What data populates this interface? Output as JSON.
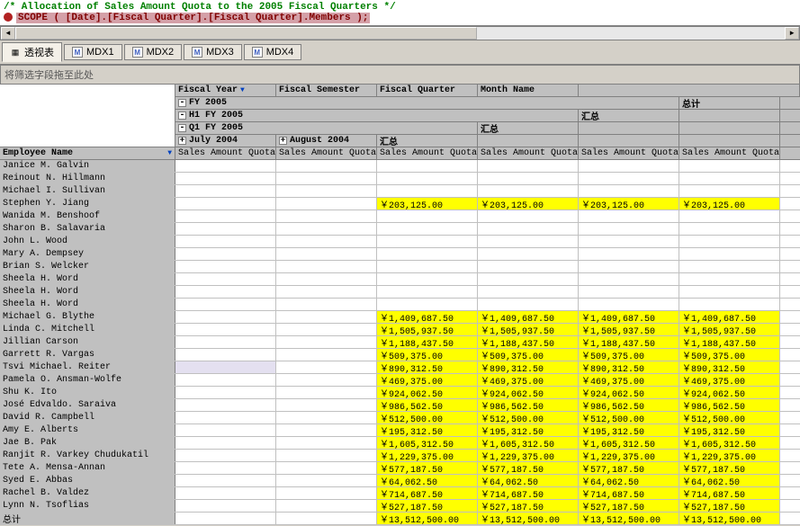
{
  "code": {
    "line1": "/* Allocation of Sales Amount Quota to the 2005 Fiscal Quarters */",
    "line2": "SCOPE ( [Date].[Fiscal Quarter].[Fiscal Quarter].Members );"
  },
  "tabs": {
    "pivot": "透视表",
    "mdx1": "MDX1",
    "mdx2": "MDX2",
    "mdx3": "MDX3",
    "mdx4": "MDX4"
  },
  "drop_label": "将筛选字段拖至此处",
  "col_fields": {
    "fiscal_year": "Fiscal Year",
    "fiscal_semester": "Fiscal Semester",
    "fiscal_quarter": "Fiscal Quarter",
    "month_name": "Month Name"
  },
  "row_field": "Employee Name",
  "measure": "Sales Amount Quota",
  "hierarchy": {
    "fy": "FY 2005",
    "h1": "H1 FY 2005",
    "q1": "Q1 FY 2005",
    "m1": "July 2004",
    "m2": "August 2004",
    "subtotal": "汇总",
    "grandtotal": "总计"
  },
  "rows": [
    {
      "name": "Janice M. Galvin",
      "v": [
        "",
        "",
        "",
        "",
        "",
        ""
      ]
    },
    {
      "name": "Reinout N. Hillmann",
      "v": [
        "",
        "",
        "",
        "",
        "",
        ""
      ]
    },
    {
      "name": "Michael I. Sullivan",
      "v": [
        "",
        "",
        "",
        "",
        "",
        ""
      ]
    },
    {
      "name": "Stephen Y. Jiang",
      "v": [
        "",
        "",
        "￥203,125.00",
        "￥203,125.00",
        "￥203,125.00",
        "￥203,125.00"
      ],
      "hl": true
    },
    {
      "name": "Wanida M. Benshoof",
      "v": [
        "",
        "",
        "",
        "",
        "",
        ""
      ]
    },
    {
      "name": "Sharon B. Salavaria",
      "v": [
        "",
        "",
        "",
        "",
        "",
        ""
      ]
    },
    {
      "name": "John L. Wood",
      "v": [
        "",
        "",
        "",
        "",
        "",
        ""
      ]
    },
    {
      "name": "Mary A. Dempsey",
      "v": [
        "",
        "",
        "",
        "",
        "",
        ""
      ]
    },
    {
      "name": "Brian S. Welcker",
      "v": [
        "",
        "",
        "",
        "",
        "",
        ""
      ]
    },
    {
      "name": "Sheela H. Word",
      "v": [
        "",
        "",
        "",
        "",
        "",
        ""
      ]
    },
    {
      "name": "Sheela H. Word",
      "v": [
        "",
        "",
        "",
        "",
        "",
        ""
      ]
    },
    {
      "name": "Sheela H. Word",
      "v": [
        "",
        "",
        "",
        "",
        "",
        ""
      ]
    },
    {
      "name": "Michael G. Blythe",
      "v": [
        "",
        "",
        "￥1,409,687.50",
        "￥1,409,687.50",
        "￥1,409,687.50",
        "￥1,409,687.50"
      ],
      "hl": true
    },
    {
      "name": "Linda C. Mitchell",
      "v": [
        "",
        "",
        "￥1,505,937.50",
        "￥1,505,937.50",
        "￥1,505,937.50",
        "￥1,505,937.50"
      ],
      "hl": true
    },
    {
      "name": "Jillian Carson",
      "v": [
        "",
        "",
        "￥1,188,437.50",
        "￥1,188,437.50",
        "￥1,188,437.50",
        "￥1,188,437.50"
      ],
      "hl": true
    },
    {
      "name": "Garrett R. Vargas",
      "v": [
        "",
        "",
        "￥509,375.00",
        "￥509,375.00",
        "￥509,375.00",
        "￥509,375.00"
      ],
      "hl": true
    },
    {
      "name": "Tsvi Michael. Reiter",
      "v": [
        "",
        "",
        "￥890,312.50",
        "￥890,312.50",
        "￥890,312.50",
        "￥890,312.50"
      ],
      "hl": true,
      "sel": true
    },
    {
      "name": "Pamela O. Ansman-Wolfe",
      "v": [
        "",
        "",
        "￥469,375.00",
        "￥469,375.00",
        "￥469,375.00",
        "￥469,375.00"
      ],
      "hl": true
    },
    {
      "name": "Shu K. Ito",
      "v": [
        "",
        "",
        "￥924,062.50",
        "￥924,062.50",
        "￥924,062.50",
        "￥924,062.50"
      ],
      "hl": true
    },
    {
      "name": "José Edvaldo. Saraiva",
      "v": [
        "",
        "",
        "￥986,562.50",
        "￥986,562.50",
        "￥986,562.50",
        "￥986,562.50"
      ],
      "hl": true
    },
    {
      "name": "David R. Campbell",
      "v": [
        "",
        "",
        "￥512,500.00",
        "￥512,500.00",
        "￥512,500.00",
        "￥512,500.00"
      ],
      "hl": true
    },
    {
      "name": "Amy E. Alberts",
      "v": [
        "",
        "",
        "￥195,312.50",
        "￥195,312.50",
        "￥195,312.50",
        "￥195,312.50"
      ],
      "hl": true
    },
    {
      "name": "Jae B. Pak",
      "v": [
        "",
        "",
        "￥1,605,312.50",
        "￥1,605,312.50",
        "￥1,605,312.50",
        "￥1,605,312.50"
      ],
      "hl": true
    },
    {
      "name": "Ranjit R. Varkey Chudukatil",
      "v": [
        "",
        "",
        "￥1,229,375.00",
        "￥1,229,375.00",
        "￥1,229,375.00",
        "￥1,229,375.00"
      ],
      "hl": true
    },
    {
      "name": "Tete A. Mensa-Annan",
      "v": [
        "",
        "",
        "￥577,187.50",
        "￥577,187.50",
        "￥577,187.50",
        "￥577,187.50"
      ],
      "hl": true
    },
    {
      "name": "Syed E. Abbas",
      "v": [
        "",
        "",
        "￥64,062.50",
        "￥64,062.50",
        "￥64,062.50",
        "￥64,062.50"
      ],
      "hl": true
    },
    {
      "name": "Rachel B. Valdez",
      "v": [
        "",
        "",
        "￥714,687.50",
        "￥714,687.50",
        "￥714,687.50",
        "￥714,687.50"
      ],
      "hl": true
    },
    {
      "name": "Lynn N. Tsoflias",
      "v": [
        "",
        "",
        "￥527,187.50",
        "￥527,187.50",
        "￥527,187.50",
        "￥527,187.50"
      ],
      "hl": true
    },
    {
      "name": "总计",
      "v": [
        "",
        "",
        "￥13,512,500.00",
        "￥13,512,500.00",
        "￥13,512,500.00",
        "￥13,512,500.00"
      ],
      "hl": true
    }
  ]
}
